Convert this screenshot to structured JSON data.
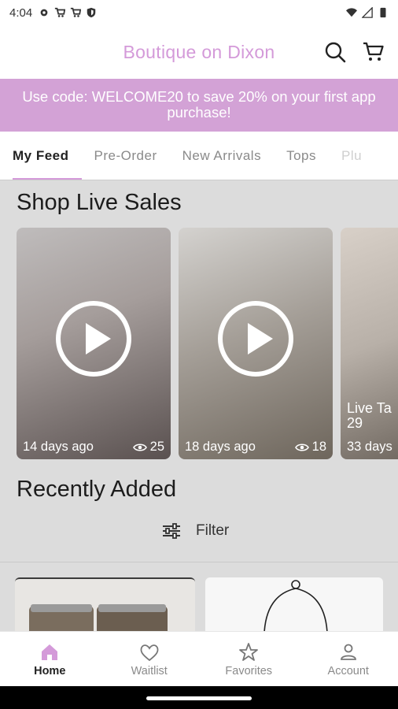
{
  "status": {
    "time": "4:04",
    "left_icons": [
      "gear-icon",
      "cart-icon",
      "cart-icon",
      "shield-icon"
    ],
    "right_icons": [
      "wifi-icon",
      "signal-icon",
      "battery-icon"
    ]
  },
  "header": {
    "title": "Boutique on Dixon"
  },
  "banner": {
    "text": "Use code: WELCOME20 to save 20% on your first app purchase!"
  },
  "tabs": [
    {
      "label": "My Feed",
      "active": true
    },
    {
      "label": "Pre-Order"
    },
    {
      "label": "New Arrivals"
    },
    {
      "label": "Tops"
    },
    {
      "label": "Plu"
    }
  ],
  "live_sales": {
    "heading": "Shop Live Sales",
    "cards": [
      {
        "time": "14 days ago",
        "views": "25"
      },
      {
        "time": "18 days ago",
        "views": "18"
      },
      {
        "title_line1": "Live Ta",
        "title_line2": "29",
        "time": "33 days"
      }
    ]
  },
  "recently_added": {
    "heading": "Recently Added",
    "filter_label": "Filter"
  },
  "bottom_nav": [
    {
      "label": "Home",
      "icon": "home-icon",
      "active": true
    },
    {
      "label": "Waitlist",
      "icon": "heart-icon"
    },
    {
      "label": "Favorites",
      "icon": "star-icon"
    },
    {
      "label": "Account",
      "icon": "person-icon"
    }
  ],
  "colors": {
    "brand": "#d49ad9",
    "banner": "#d3a2d6",
    "home_icon": "#d49ad9"
  }
}
